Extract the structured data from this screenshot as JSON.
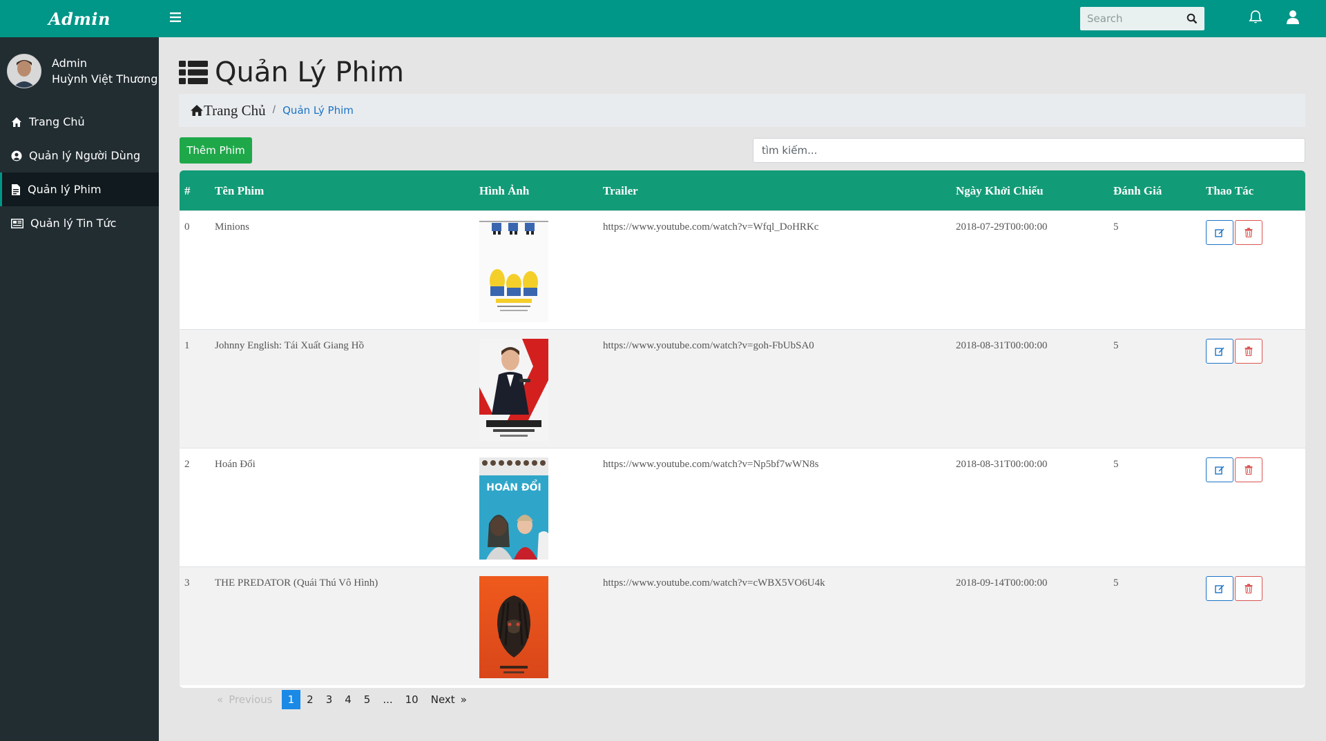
{
  "brand": "Admin",
  "user": {
    "role": "Admin",
    "name": "Huỳnh Việt Thương"
  },
  "nav": [
    {
      "label": "Trang Chủ",
      "icon": "home-icon"
    },
    {
      "label": "Quản lý Người Dùng",
      "icon": "user-circle-icon"
    },
    {
      "label": "Quản lý Phim",
      "icon": "file-icon",
      "active": true
    },
    {
      "label": "Quản lý Tin Tức",
      "icon": "newspaper-icon"
    }
  ],
  "topbar": {
    "search_placeholder": "Search"
  },
  "page": {
    "title": "Quản Lý Phim"
  },
  "breadcrumb": {
    "home": "Trang Chủ",
    "separator": "/",
    "current": "Quản Lý Phim"
  },
  "toolbar": {
    "add_label": "Thêm Phim",
    "search_placeholder": "tìm kiếm..."
  },
  "table": {
    "headers": [
      "#",
      "Tên Phim",
      "Hình Ảnh",
      "Trailer",
      "Ngày Khởi Chiếu",
      "Đánh Giá",
      "Thao Tác"
    ],
    "rows": [
      {
        "index": "0",
        "name": "Minions",
        "poster": "minions-poster",
        "trailer": "https://www.youtube.com/watch?v=Wfql_DoHRKc",
        "date": "2018-07-29T00:00:00",
        "rating": "5"
      },
      {
        "index": "1",
        "name": "Johnny English: Tái Xuất Giang Hồ",
        "poster": "johnny-english-poster",
        "trailer": "https://www.youtube.com/watch?v=goh-FbUbSA0",
        "date": "2018-08-31T00:00:00",
        "rating": "5"
      },
      {
        "index": "2",
        "name": "Hoán Đổi",
        "poster": "hoan-doi-poster",
        "trailer": "https://www.youtube.com/watch?v=Np5bf7wWN8s",
        "date": "2018-08-31T00:00:00",
        "rating": "5"
      },
      {
        "index": "3",
        "name": "THE PREDATOR (Quái Thú Vô Hình)",
        "poster": "predator-poster",
        "trailer": "https://www.youtube.com/watch?v=cWBX5VO6U4k",
        "date": "2018-09-14T00:00:00",
        "rating": "5"
      }
    ]
  },
  "pagination": {
    "prev_arrow": "«",
    "previous": "Previous",
    "pages": [
      "1",
      "2",
      "3",
      "4",
      "5",
      "...",
      "10"
    ],
    "next": "Next",
    "next_arrow": "»",
    "current": "1"
  },
  "poster_texts": {
    "hoan_doi": "HOÁN ĐỔI"
  },
  "colors": {
    "teal": "#009688",
    "sidebar": "#222d32",
    "table_header": "#129b77",
    "add_button": "#1fa84a",
    "page_active": "#1a8ae6"
  }
}
